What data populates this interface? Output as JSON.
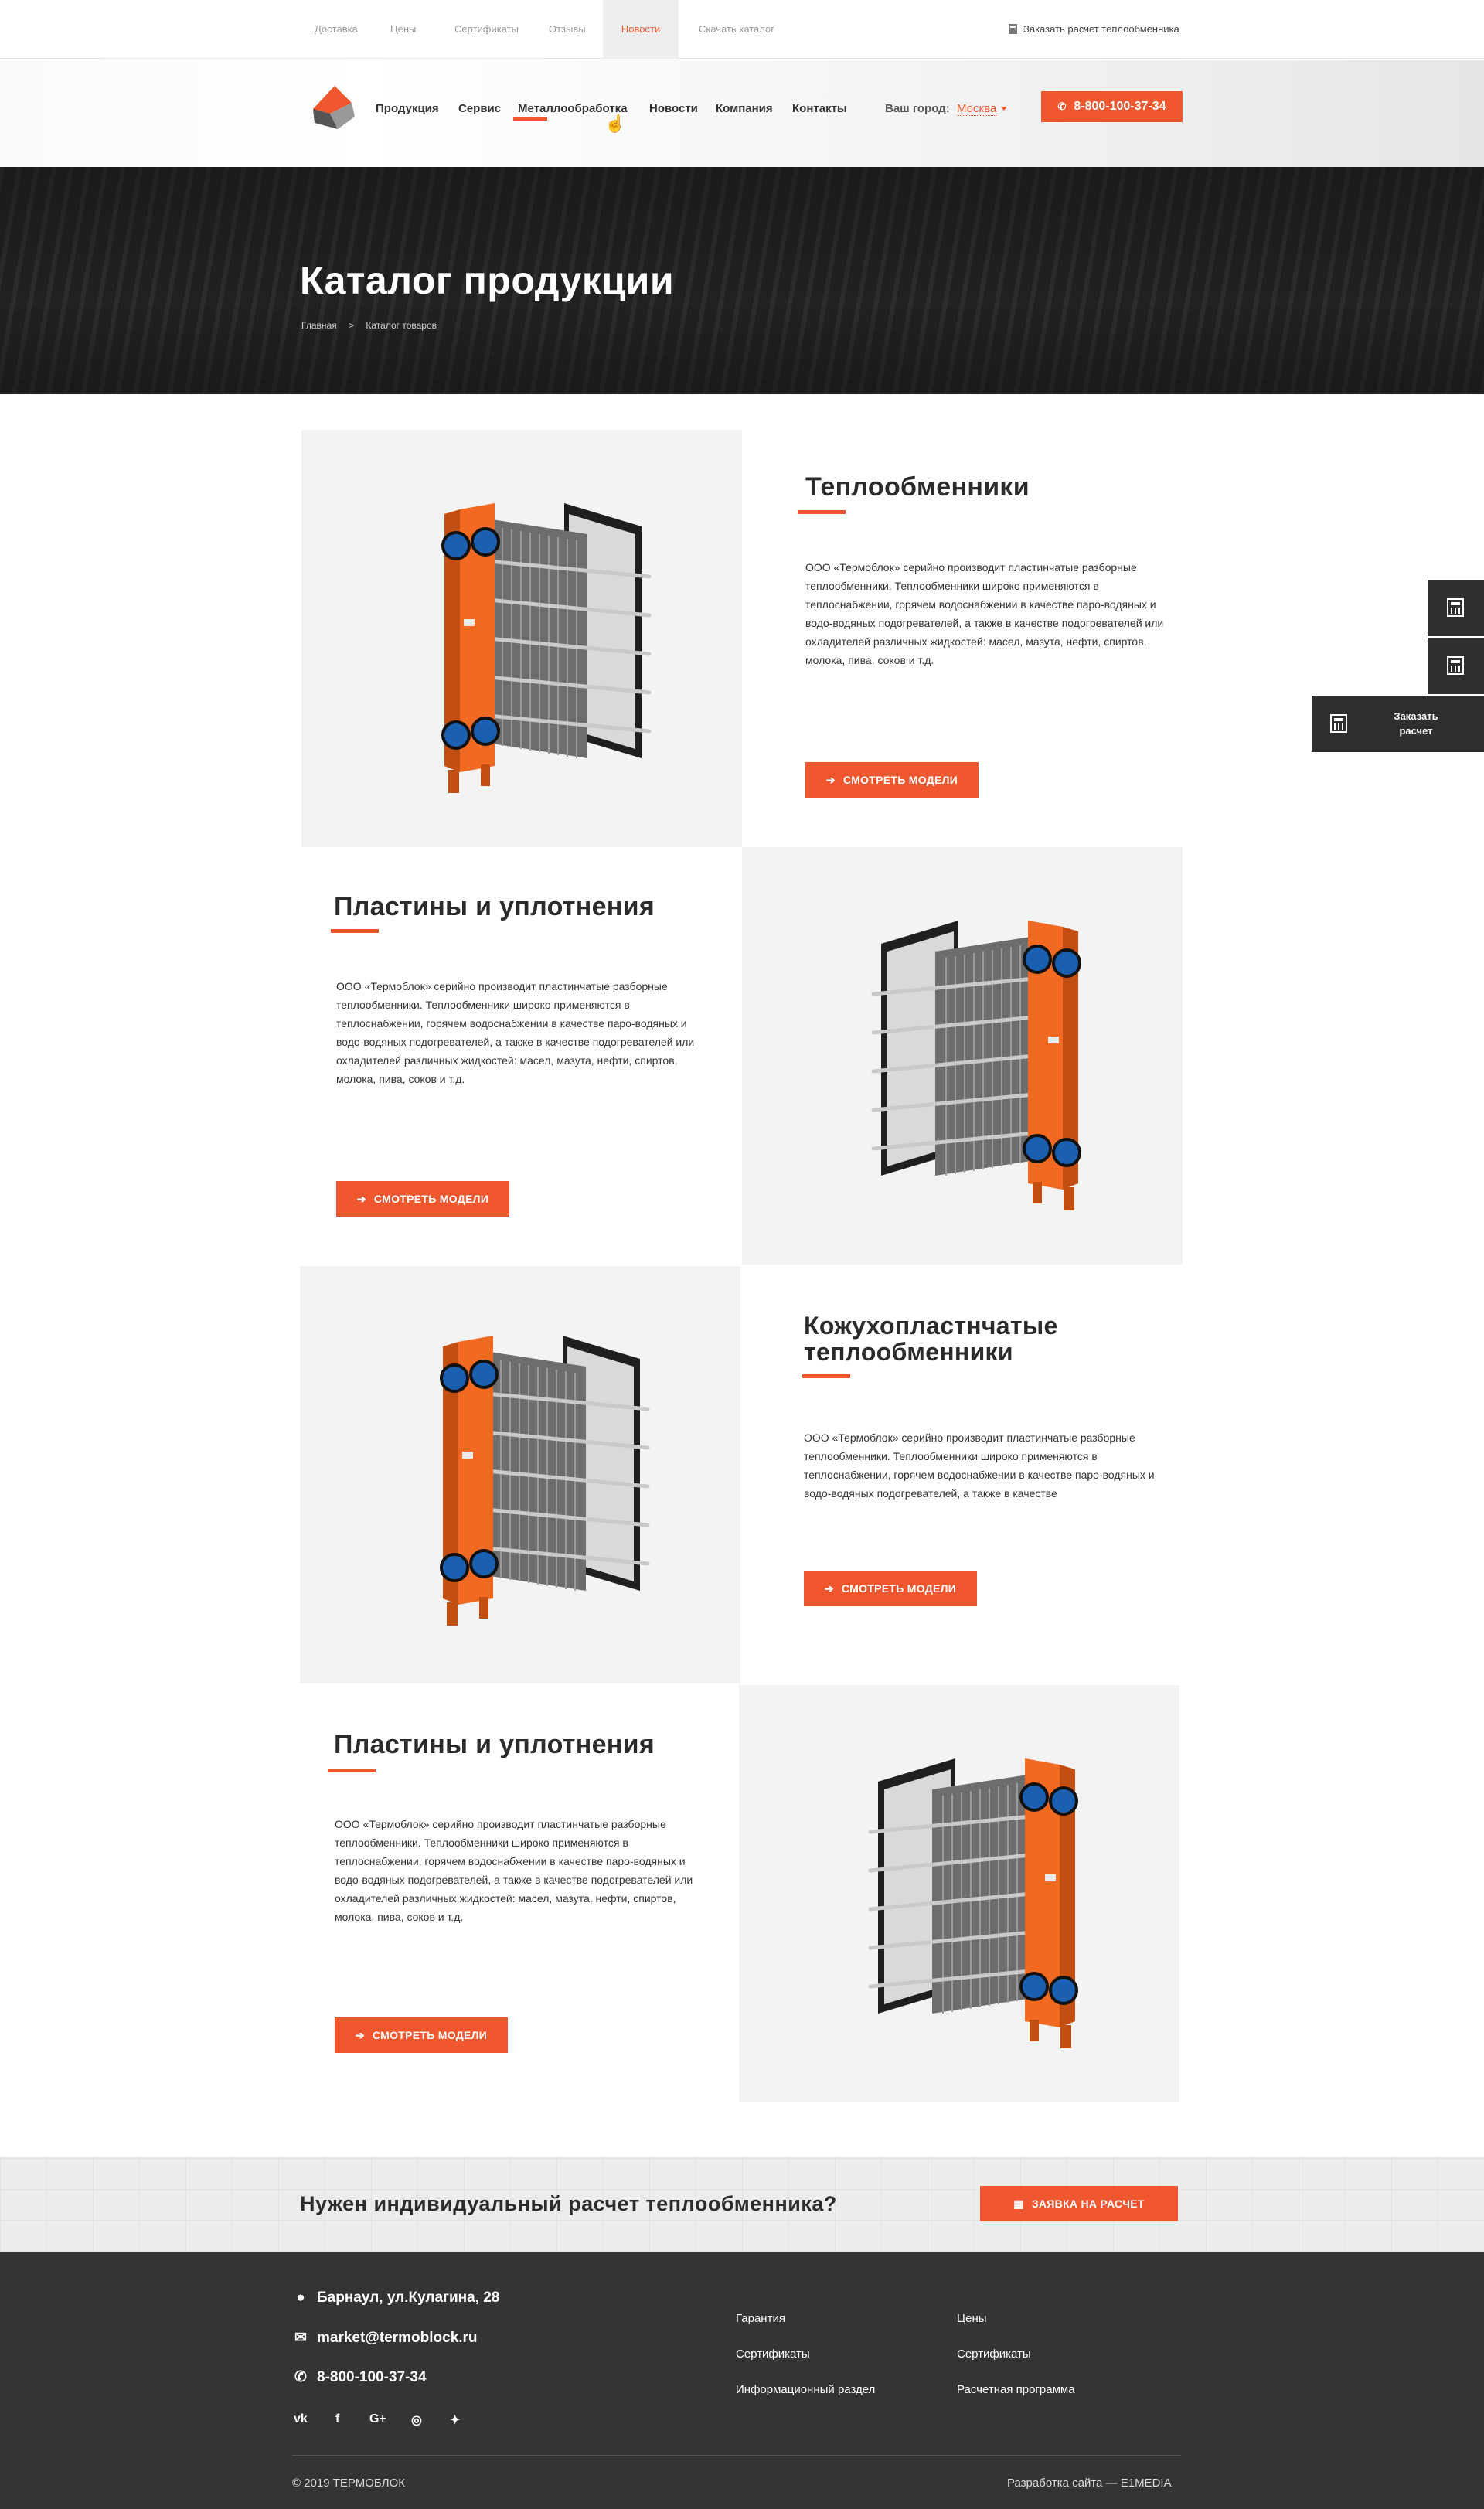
{
  "topbar": {
    "links": [
      "Доставка",
      "Цены",
      "Сертификаты",
      "Отзывы",
      "Новости",
      "Скачать каталог"
    ],
    "active": "Новости",
    "order_label": "Заказать расчет теплообменника"
  },
  "header": {
    "nav": [
      "Продукция",
      "Сервис",
      "Металлообработка",
      "Новости",
      "Компания",
      "Контакты"
    ],
    "active_nav": "Металлообработка",
    "city_label": "Ваш город:",
    "city_value": "Москва",
    "phone": "8-800-100-37-34"
  },
  "hero": {
    "title": "Каталог продукции",
    "breadcrumb": [
      "Главная",
      ">",
      "Каталог товаров"
    ]
  },
  "catalog": [
    {
      "title_lines": [
        "Теплообменники"
      ],
      "text": "ООО «Термоблок» серийно производит пластинчатые разборные теплообменники. Теплообменники широко применяются в теплоснабжении, горячем водоснабжении в качестве паро-водяных и водо-водяных подогревателей, а также в качестве подогревателей или охладителей различных жидкостей: масел, мазута, нефти, спиртов, молока, пива, соков и т.д.",
      "button": "СМОТРЕТЬ МОДЕЛИ"
    },
    {
      "title_lines": [
        "Пластины и уплотнения"
      ],
      "text": "ООО «Термоблок» серийно производит пластинчатые разборные теплообменники. Теплообменники широко применяются в теплоснабжении, горячем водоснабжении в качестве паро-водяных и водо-водяных подогревателей, а также в качестве подогревателей или охладителей различных жидкостей: масел, мазута, нефти, спиртов, молока, пива, соков и т.д.",
      "button": "СМОТРЕТЬ МОДЕЛИ"
    },
    {
      "title_lines": [
        "Кожухопластнчатые",
        "теплообменники"
      ],
      "text": "ООО «Термоблок» серийно производит пластинчатые разборные теплообменники. Теплообменники широко применяются в теплоснабжении, горячем водоснабжении в качестве паро-водяных и водо-водяных подогревателей, а также в качестве",
      "button": "СМОТРЕТЬ МОДЕЛИ"
    },
    {
      "title_lines": [
        "Пластины и уплотнения"
      ],
      "text": "ООО «Термоблок» серийно производит пластинчатые разборные теплообменники. Теплообменники широко применяются в теплоснабжении, горячем водоснабжении в качестве паро-водяных и водо-водяных подогревателей, а также в качестве подогревателей или охладителей различных жидкостей: масел, мазута, нефти, спиртов, молока, пива, соков и т.д.",
      "button": "СМОТРЕТЬ МОДЕЛИ"
    }
  ],
  "side": {
    "order_lines": [
      "Заказать",
      "расчет"
    ]
  },
  "cta": {
    "title": "Нужен индивидуальный расчет теплообменника?",
    "button": "ЗАЯВКА НА РАСЧЕТ"
  },
  "footer": {
    "address": "Барнаул, ул.Кулагина, 28",
    "email": "market@termoblock.ru",
    "phone": "8-800-100-37-34",
    "links_col1": [
      "Гарантия",
      "Сертификаты",
      "Информационный раздел"
    ],
    "links_col2": [
      "Цены",
      "Сертификаты",
      "Расчетная программа"
    ],
    "social": [
      "vk-icon",
      "facebook-icon",
      "google-plus-icon",
      "instagram-icon",
      "twitter-icon"
    ],
    "copyright": "© 2019 ТЕРМОБЛОК",
    "developer": "Разработка сайта — E1MEDIA"
  },
  "colors": {
    "accent": "#f0572e",
    "dark": "#343434",
    "light_bg": "#f3f3f3"
  }
}
